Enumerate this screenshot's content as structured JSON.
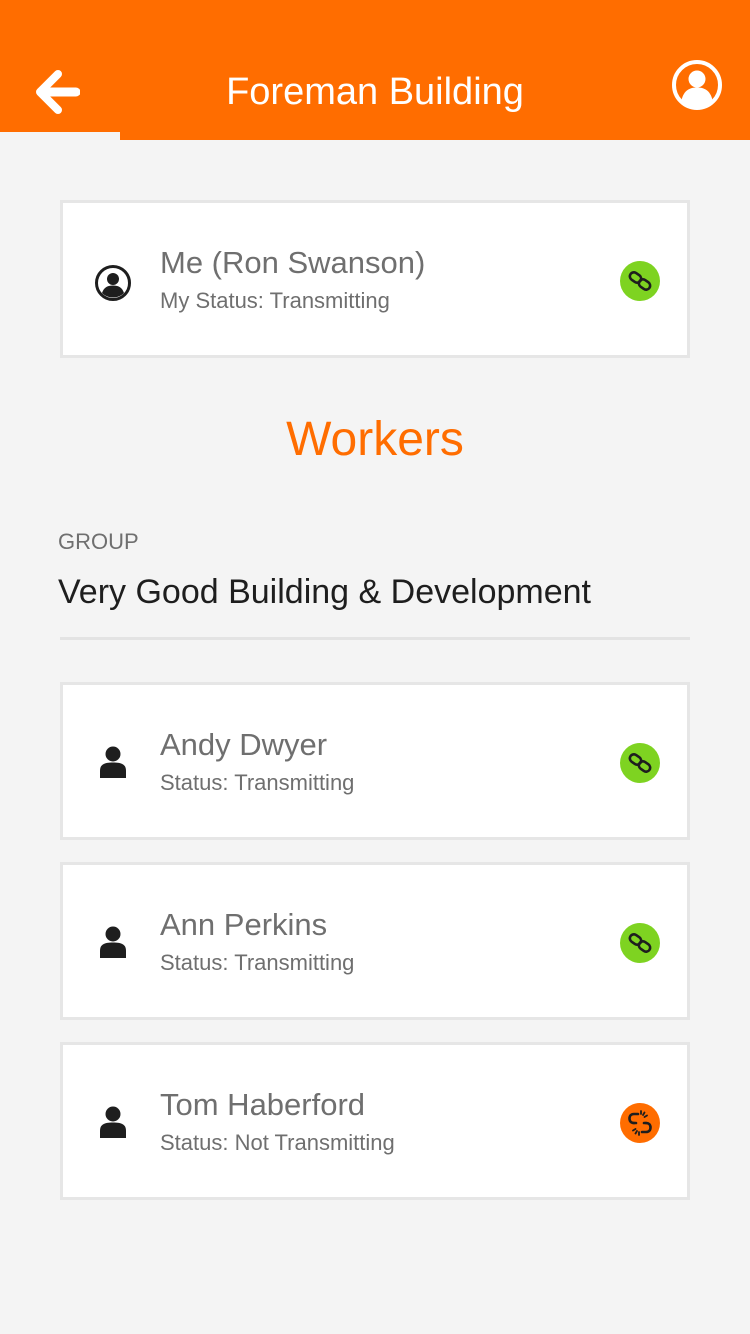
{
  "header": {
    "title": "Foreman Building",
    "back_icon": "arrow-left-icon",
    "profile_icon": "user-circle-icon",
    "accent_color": "#ff6d00"
  },
  "me": {
    "name": "Me (Ron Swanson)",
    "status": "My Status: Transmitting",
    "connection": "connected"
  },
  "workers_title": "Workers",
  "group": {
    "label": "GROUP",
    "name": "Very Good Building & Development"
  },
  "workers": [
    {
      "name": "Andy Dwyer",
      "status": "Status: Transmitting",
      "connection": "connected"
    },
    {
      "name": "Ann Perkins",
      "status": "Status: Transmitting",
      "connection": "connected"
    },
    {
      "name": "Tom Haberford",
      "status": "Status: Not Transmitting",
      "connection": "disconnected"
    }
  ],
  "colors": {
    "connected": "#7ed321",
    "disconnected": "#ff6d00"
  }
}
